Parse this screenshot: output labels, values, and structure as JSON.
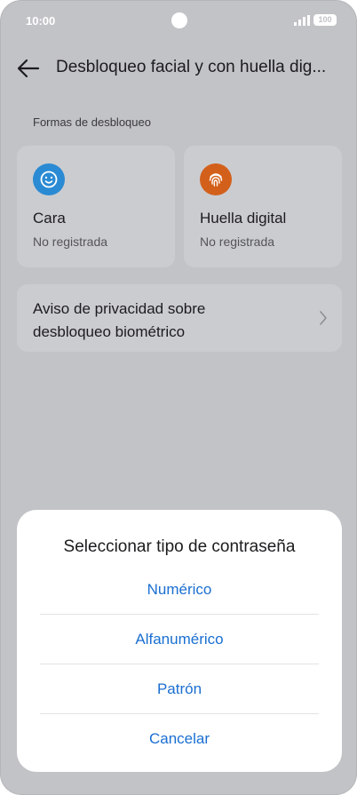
{
  "status": {
    "time": "10:00",
    "battery": "100"
  },
  "header": {
    "title": "Desbloqueo facial y con huella dig..."
  },
  "section": {
    "title": "Formas de desbloqueo"
  },
  "cards": {
    "face": {
      "title": "Cara",
      "status": "No registrada",
      "icon": "face-smile-icon"
    },
    "fingerprint": {
      "title": "Huella digital",
      "status": "No registrada",
      "icon": "fingerprint-icon"
    }
  },
  "privacy": {
    "line1": "Aviso de privacidad sobre",
    "line2": "desbloqueo biométrico"
  },
  "sheet": {
    "title": "Seleccionar tipo de contraseña",
    "options": [
      "Numérico",
      "Alfanumérico",
      "Patrón"
    ],
    "cancel": "Cancelar"
  },
  "colors": {
    "accent": "#1a6fd1",
    "face_icon": "#2a8ad4",
    "finger_icon": "#d3601a",
    "overlay": "#c2c3c7"
  }
}
